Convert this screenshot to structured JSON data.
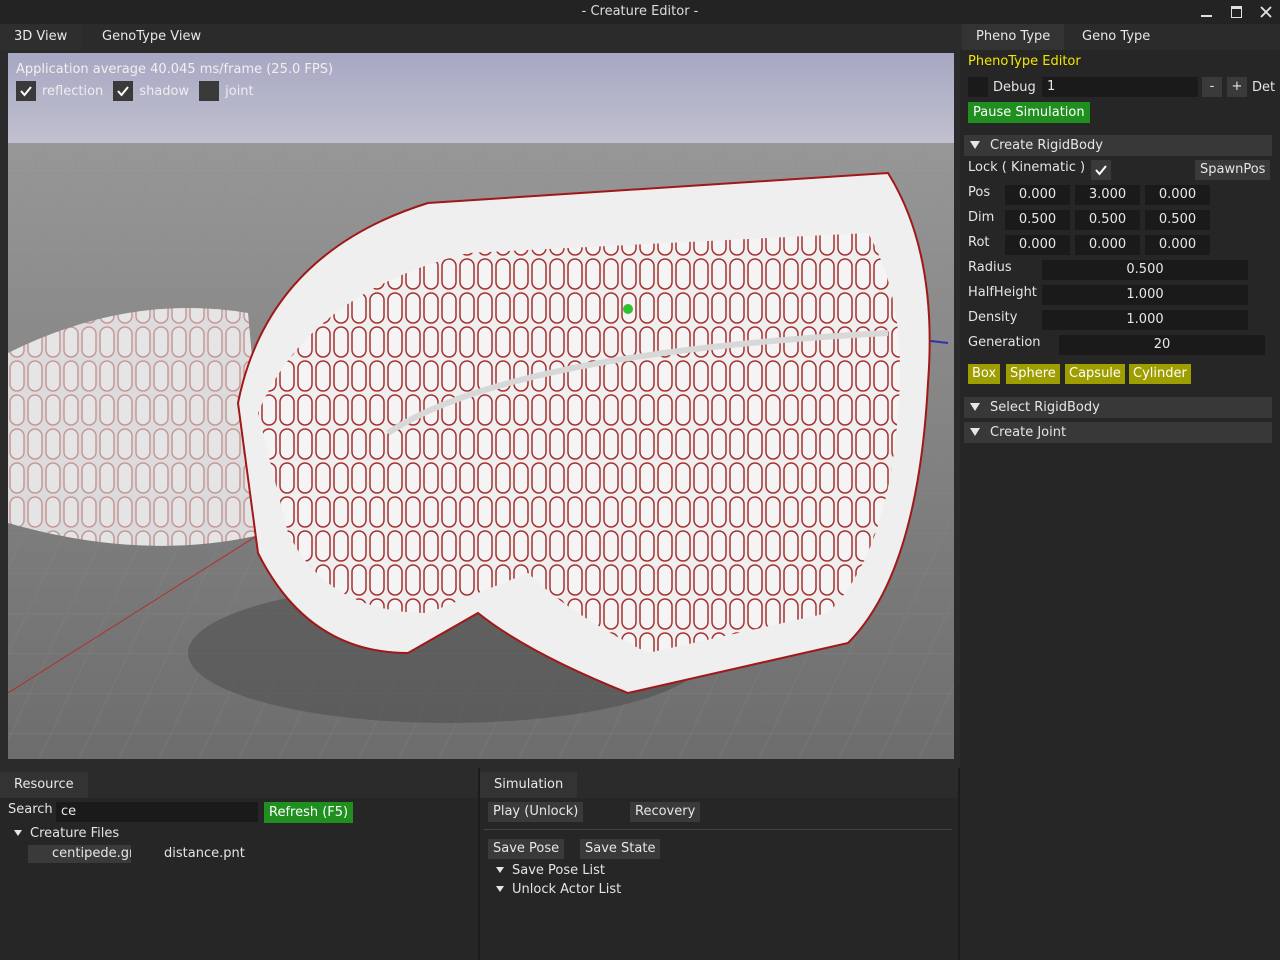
{
  "window": {
    "title": "- Creature Editor -"
  },
  "left_tabs": [
    {
      "label": "3D View"
    },
    {
      "label": "GenoType View"
    }
  ],
  "viewport": {
    "fps_text": "Application average 40.045 ms/frame (25.0 FPS)",
    "checkboxes": [
      {
        "label": "reflection",
        "checked": true
      },
      {
        "label": "shadow",
        "checked": true
      },
      {
        "label": "joint",
        "checked": false
      }
    ]
  },
  "right_tabs": [
    {
      "label": "Pheno Type"
    },
    {
      "label": "Geno Type"
    }
  ],
  "pheno_editor": {
    "title": "PhenoType Editor",
    "debug": {
      "label": "Debug",
      "value": "1",
      "minus": "-",
      "plus": "+",
      "trailing": "Det"
    },
    "pause_button": "Pause Simulation",
    "create_rigidbody": {
      "header": "Create RigidBody",
      "lock_label": "Lock ( Kinematic )",
      "lock_checked": true,
      "spawn_button": "SpawnPos",
      "pos": {
        "label": "Pos",
        "values": [
          "0.000",
          "3.000",
          "0.000"
        ]
      },
      "dim": {
        "label": "Dim",
        "values": [
          "0.500",
          "0.500",
          "0.500"
        ]
      },
      "rot": {
        "label": "Rot",
        "values": [
          "0.000",
          "0.000",
          "0.000"
        ]
      },
      "radius": {
        "label": "Radius",
        "value": "0.500"
      },
      "halfheight": {
        "label": "HalfHeight",
        "value": "1.000"
      },
      "density": {
        "label": "Density",
        "value": "1.000"
      },
      "generation": {
        "label": "Generation",
        "value": "20"
      },
      "shape_buttons": [
        "Box",
        "Sphere",
        "Capsule",
        "Cylinder"
      ]
    },
    "select_rigidbody_header": "Select RigidBody",
    "create_joint_header": "Create Joint"
  },
  "resource": {
    "tab": "Resource",
    "search_label": "Search",
    "search_value": "ce",
    "refresh_button": "Refresh (F5)",
    "tree_label": "Creature Files",
    "files": [
      "centipede.gn",
      "distance.pnt"
    ]
  },
  "simulation": {
    "tab": "Simulation",
    "play_button": "Play (Unlock)",
    "recovery_button": "Recovery",
    "save_pose_button": "Save Pose",
    "save_state_button": "Save State",
    "tree_items": [
      "Save Pose List",
      "Unlock Actor List"
    ]
  },
  "colors": {
    "accent_yellow": "#f2e600",
    "button_green": "#1f8f1f",
    "button_olive": "#9e9e00",
    "creature_white": "#f4f4f4",
    "creature_outline": "#b01818",
    "floor_gray": "#7d7d7d",
    "sky": "#b4b4cc"
  }
}
